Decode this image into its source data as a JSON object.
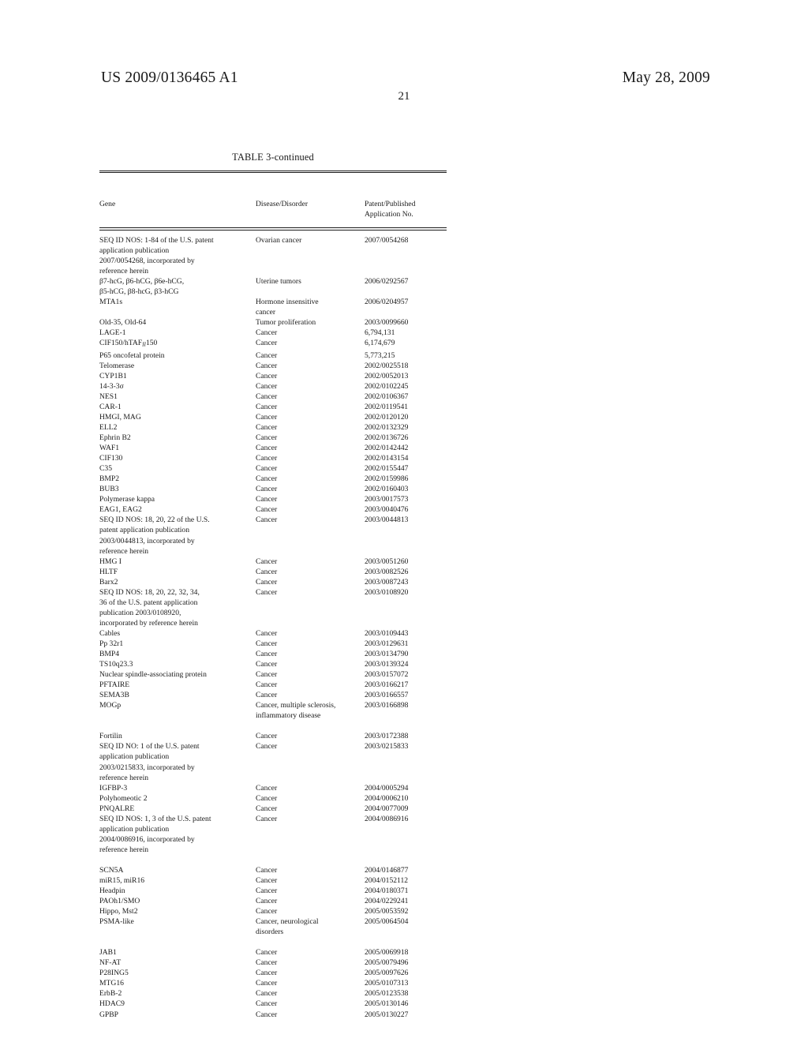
{
  "document": {
    "publication_number": "US 2009/0136465 A1",
    "publication_date": "May 28, 2009",
    "page_number": "21",
    "table_caption": "TABLE 3-continued"
  },
  "table": {
    "columns": [
      {
        "key": "gene",
        "header": "Gene"
      },
      {
        "key": "disease",
        "header": "Disease/Disorder"
      },
      {
        "key": "application",
        "header_line1": "Patent/Published",
        "header_line2": "Application No."
      }
    ],
    "rows": [
      {
        "gene": "SEQ ID NOS: 1-84 of the U.S. patent\napplication publication\n2007/0054268, incorporated by\nreference herein",
        "disease": "Ovarian cancer",
        "application": "2007/0054268"
      },
      {
        "gene": "β7-hcG, β6-hCG, β6e-hCG,\nβ5-hCG, β8-hcG, β3-hCG",
        "disease": "Uterine tumors",
        "application": "2006/0292567"
      },
      {
        "gene": "MTA1s",
        "disease": "Hormone insensitive\ncancer",
        "application": "2006/0204957"
      },
      {
        "gene": "Old-35, Old-64",
        "disease": "Tumor proliferation",
        "application": "2003/0099660"
      },
      {
        "gene": "LAGE-1",
        "disease": "Cancer",
        "application": "6,794,131"
      },
      {
        "gene": "CIF150/hTAF_II_150",
        "gene_html": true,
        "disease": "Cancer",
        "application": "6,174,679"
      },
      {
        "gene": "P65 oncofetal protein",
        "disease": "Cancer",
        "application": "5,773,215"
      },
      {
        "gene": "Telomerase",
        "disease": "Cancer",
        "application": "2002/0025518"
      },
      {
        "gene": "CYP1B1",
        "disease": "Cancer",
        "application": "2002/0052013"
      },
      {
        "gene": "14-3-3σ",
        "disease": "Cancer",
        "application": "2002/0102245"
      },
      {
        "gene": "NES1",
        "disease": "Cancer",
        "application": "2002/0106367"
      },
      {
        "gene": "CAR-1",
        "disease": "Cancer",
        "application": "2002/0119541"
      },
      {
        "gene": "HMGI, MAG",
        "disease": "Cancer",
        "application": "2002/0120120"
      },
      {
        "gene": "ELL2",
        "disease": "Cancer",
        "application": "2002/0132329"
      },
      {
        "gene": "Ephrin B2",
        "disease": "Cancer",
        "application": "2002/0136726"
      },
      {
        "gene": "WAF1",
        "disease": "Cancer",
        "application": "2002/0142442"
      },
      {
        "gene": "CIF130",
        "disease": "Cancer",
        "application": "2002/0143154"
      },
      {
        "gene": "C35",
        "disease": "Cancer",
        "application": "2002/0155447"
      },
      {
        "gene": "BMP2",
        "disease": "Cancer",
        "application": "2002/0159986"
      },
      {
        "gene": "BUB3",
        "disease": "Cancer",
        "application": "2002/0160403"
      },
      {
        "gene": "Polymerase kappa",
        "disease": "Cancer",
        "application": "2003/0017573"
      },
      {
        "gene": "EAG1, EAG2",
        "disease": "Cancer",
        "application": "2003/0040476"
      },
      {
        "gene": "SEQ ID NOS: 18, 20, 22 of the U.S.\npatent application publication\n2003/0044813, incorporated by\nreference herein",
        "disease": "Cancer",
        "application": "2003/0044813"
      },
      {
        "gene": "HMG I",
        "disease": "Cancer",
        "application": "2003/0051260"
      },
      {
        "gene": "HLTF",
        "disease": "Cancer",
        "application": "2003/0082526"
      },
      {
        "gene": "Barx2",
        "disease": "Cancer",
        "application": "2003/0087243"
      },
      {
        "gene": "SEQ ID NOS: 18, 20, 22, 32, 34,\n36 of the U.S. patent application\npublication 2003/0108920,\nincorporated by reference herein",
        "disease": "Cancer",
        "application": "2003/0108920"
      },
      {
        "gene": "Cables",
        "disease": "Cancer",
        "application": "2003/0109443"
      },
      {
        "gene": "Pp 32r1",
        "disease": "Cancer",
        "application": "2003/0129631"
      },
      {
        "gene": "BMP4",
        "disease": "Cancer",
        "application": "2003/0134790"
      },
      {
        "gene": "TS10q23.3",
        "disease": "Cancer",
        "application": "2003/0139324"
      },
      {
        "gene": "Nuclear spindle-associating protein",
        "disease": "Cancer",
        "application": "2003/0157072"
      },
      {
        "gene": "PFTAIRE",
        "disease": "Cancer",
        "application": "2003/0166217"
      },
      {
        "gene": "SEMA3B",
        "disease": "Cancer",
        "application": "2003/0166557"
      },
      {
        "gene": "MOGp",
        "disease": "Cancer, multiple sclerosis,\ninflammatory disease",
        "application": "2003/0166898"
      },
      {
        "gene": "Fortilin",
        "disease": "Cancer",
        "application": "2003/0172388"
      },
      {
        "gene": "SEQ ID NO: 1 of the U.S. patent\napplication publication\n2003/0215833, incorporated by\nreference herein",
        "disease": "Cancer",
        "application": "2003/0215833"
      },
      {
        "gene": "IGFBP-3",
        "disease": "Cancer",
        "application": "2004/0005294"
      },
      {
        "gene": "Polyhomeotic 2",
        "disease": "Cancer",
        "application": "2004/0006210"
      },
      {
        "gene": "PNQALRE",
        "disease": "Cancer",
        "application": "2004/0077009"
      },
      {
        "gene": "SEQ ID NOS: 1, 3 of the U.S. patent\napplication publication\n2004/0086916, incorporated by\nreference herein",
        "disease": "Cancer",
        "application": "2004/0086916"
      },
      {
        "gene": "SCN5A",
        "disease": "Cancer",
        "application": "2004/0146877"
      },
      {
        "gene": "miR15, miR16",
        "disease": "Cancer",
        "application": "2004/0152112"
      },
      {
        "gene": "Headpin",
        "disease": "Cancer",
        "application": "2004/0180371"
      },
      {
        "gene": "PAOh1/SMO",
        "disease": "Cancer",
        "application": "2004/0229241"
      },
      {
        "gene": "Hippo, Mst2",
        "disease": "Cancer",
        "application": "2005/0053592"
      },
      {
        "gene": "PSMA-like",
        "disease": "Cancer, neurological\ndisorders",
        "application": "2005/0064504"
      },
      {
        "gene": "JAB1",
        "disease": "Cancer",
        "application": "2005/0069918"
      },
      {
        "gene": "NF-AT",
        "disease": "Cancer",
        "application": "2005/0079496"
      },
      {
        "gene": "P28ING5",
        "disease": "Cancer",
        "application": "2005/0097626"
      },
      {
        "gene": "MTG16",
        "disease": "Cancer",
        "application": "2005/0107313"
      },
      {
        "gene": "ErbB-2",
        "disease": "Cancer",
        "application": "2005/0123538"
      },
      {
        "gene": "HDAC9",
        "disease": "Cancer",
        "application": "2005/0130146"
      },
      {
        "gene": "GPBP",
        "disease": "Cancer",
        "application": "2005/0130227"
      }
    ],
    "gap_after_row_indexes": [
      34,
      40,
      46
    ]
  }
}
